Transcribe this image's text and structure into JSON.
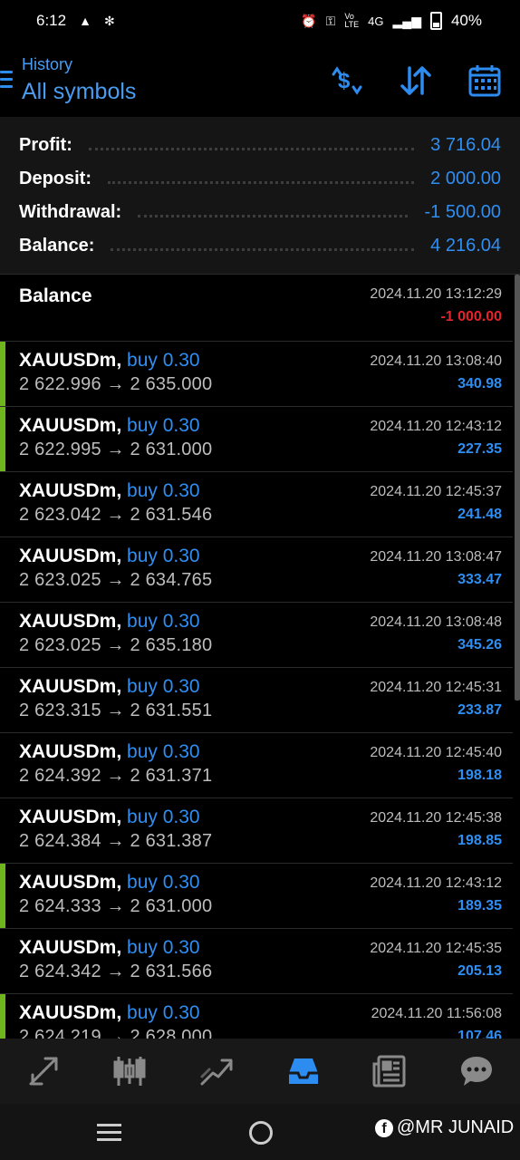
{
  "status_bar": {
    "time": "6:12",
    "signal_text": "4G",
    "battery": "40%"
  },
  "header": {
    "subtitle": "History",
    "title": "All symbols",
    "icons": [
      "dollar-sync-icon",
      "sort-icon",
      "calendar-icon"
    ]
  },
  "summary": {
    "profit_label": "Profit:",
    "profit_value": "3 716.04",
    "deposit_label": "Deposit:",
    "deposit_value": "2 000.00",
    "withdrawal_label": "Withdrawal:",
    "withdrawal_value": "-1 500.00",
    "balance_label": "Balance:",
    "balance_value": "4 216.04"
  },
  "balance_entry": {
    "label": "Balance",
    "time": "2024.11.20 13:12:29",
    "amount": "-1 000.00"
  },
  "deals": [
    {
      "symbol": "XAUUSDm,",
      "action": "buy 0.30",
      "prices": "2 622.996 → 2 635.000",
      "time": "2024.11.20 13:08:40",
      "profit": "340.98",
      "marked": true
    },
    {
      "symbol": "XAUUSDm,",
      "action": "buy 0.30",
      "prices": "2 622.995 → 2 631.000",
      "time": "2024.11.20 12:43:12",
      "profit": "227.35",
      "marked": true
    },
    {
      "symbol": "XAUUSDm,",
      "action": "buy 0.30",
      "prices": "2 623.042 → 2 631.546",
      "time": "2024.11.20 12:45:37",
      "profit": "241.48",
      "marked": false
    },
    {
      "symbol": "XAUUSDm,",
      "action": "buy 0.30",
      "prices": "2 623.025 → 2 634.765",
      "time": "2024.11.20 13:08:47",
      "profit": "333.47",
      "marked": false
    },
    {
      "symbol": "XAUUSDm,",
      "action": "buy 0.30",
      "prices": "2 623.025 → 2 635.180",
      "time": "2024.11.20 13:08:48",
      "profit": "345.26",
      "marked": false
    },
    {
      "symbol": "XAUUSDm,",
      "action": "buy 0.30",
      "prices": "2 623.315 → 2 631.551",
      "time": "2024.11.20 12:45:31",
      "profit": "233.87",
      "marked": false
    },
    {
      "symbol": "XAUUSDm,",
      "action": "buy 0.30",
      "prices": "2 624.392 → 2 631.371",
      "time": "2024.11.20 12:45:40",
      "profit": "198.18",
      "marked": false
    },
    {
      "symbol": "XAUUSDm,",
      "action": "buy 0.30",
      "prices": "2 624.384 → 2 631.387",
      "time": "2024.11.20 12:45:38",
      "profit": "198.85",
      "marked": false
    },
    {
      "symbol": "XAUUSDm,",
      "action": "buy 0.30",
      "prices": "2 624.333 → 2 631.000",
      "time": "2024.11.20 12:43:12",
      "profit": "189.35",
      "marked": true
    },
    {
      "symbol": "XAUUSDm,",
      "action": "buy 0.30",
      "prices": "2 624.342 → 2 631.566",
      "time": "2024.11.20 12:45:35",
      "profit": "205.13",
      "marked": false
    },
    {
      "symbol": "XAUUSDm,",
      "action": "buy 0.30",
      "prices": "2 624.219 → 2 628.000",
      "time": "2024.11.20 11:56:08",
      "profit": "107.46",
      "marked": true
    }
  ],
  "bottom_nav": [
    {
      "name": "quotes-icon",
      "active": false
    },
    {
      "name": "candlestick-chart-icon",
      "active": false
    },
    {
      "name": "trade-icon",
      "active": false
    },
    {
      "name": "history-icon",
      "active": true
    },
    {
      "name": "news-icon",
      "active": false
    },
    {
      "name": "chat-icon",
      "active": false
    }
  ],
  "watermark": "@MR JUNAID",
  "colors": {
    "accent": "#2f8ef2",
    "negative": "#e4232a",
    "marker": "#6fb51e",
    "background": "#000000"
  }
}
